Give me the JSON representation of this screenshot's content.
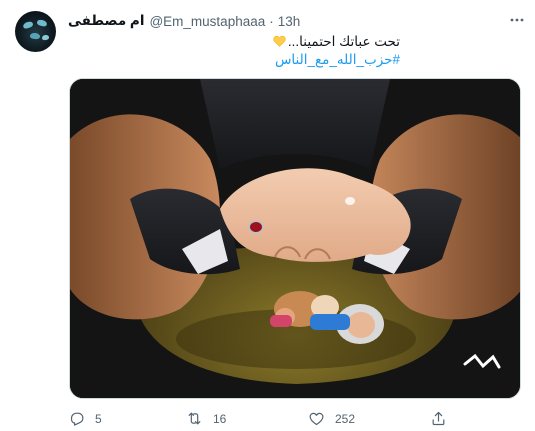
{
  "tweet": {
    "author_name": "ام مصطفى",
    "handle": "@Em_mustaphaaa",
    "separator": "·",
    "time": "13h",
    "text_line1": "تحت عباتك احتمينا...",
    "hashtag": "#حزب_الله_مع_الناس",
    "accent_color": "#1d9bf0"
  },
  "actions": {
    "reply_count": "5",
    "retweet_count": "16",
    "like_count": "252"
  },
  "icons": {
    "more": "more-icon",
    "reply": "reply-icon",
    "retweet": "retweet-icon",
    "like": "like-icon",
    "share": "share-icon",
    "emoji": "yellow-heart-emoji"
  }
}
